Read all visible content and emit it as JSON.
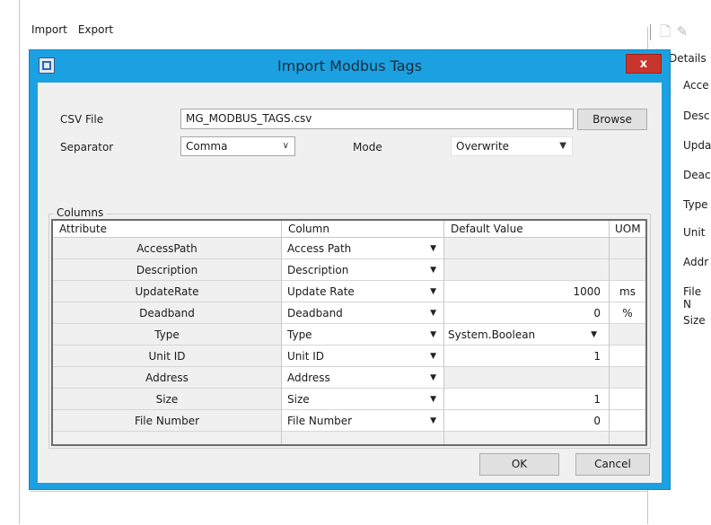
{
  "menu": {
    "import": "Import",
    "export": "Export"
  },
  "details_panel": {
    "title": "Details",
    "items": [
      "Acce",
      "Desc",
      "Upda",
      "Deac",
      "Type",
      "Unit",
      "Addr",
      "File N",
      "Size"
    ]
  },
  "dialog": {
    "title": "Import Modbus Tags",
    "close_label": "x",
    "csv_file_label": "CSV File",
    "csv_file_value": "MG_MODBUS_TAGS.csv",
    "browse_label": "Browse",
    "separator_label": "Separator",
    "separator_value": "Comma",
    "mode_label": "Mode",
    "mode_value": "Overwrite",
    "columns_group_label": "Columns",
    "headers": {
      "attribute": "Attribute",
      "column": "Column",
      "default_value": "Default Value",
      "uom": "UOM"
    },
    "rows": [
      {
        "attribute": "AccessPath",
        "column": "Access Path",
        "default": "",
        "uom": ""
      },
      {
        "attribute": "Description",
        "column": "Description",
        "default": "",
        "uom": ""
      },
      {
        "attribute": "UpdateRate",
        "column": "Update Rate",
        "default": "1000",
        "uom": "ms"
      },
      {
        "attribute": "Deadband",
        "column": "Deadband",
        "default": "0",
        "uom": "%"
      },
      {
        "attribute": "Type",
        "column": "Type",
        "default": "System.Boolean",
        "uom": ""
      },
      {
        "attribute": "Unit ID",
        "column": "Unit ID",
        "default": "1",
        "uom": ""
      },
      {
        "attribute": "Address",
        "column": "Address",
        "default": "",
        "uom": ""
      },
      {
        "attribute": "Size",
        "column": "Size",
        "default": "1",
        "uom": ""
      },
      {
        "attribute": "File Number",
        "column": "File Number",
        "default": "0",
        "uom": ""
      }
    ],
    "ok_label": "OK",
    "cancel_label": "Cancel"
  },
  "colors": {
    "dialog_frame": "#1ba1e2",
    "close_button": "#c7352c"
  }
}
